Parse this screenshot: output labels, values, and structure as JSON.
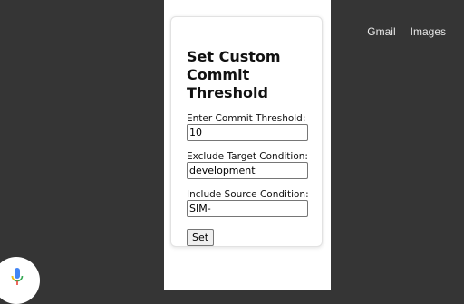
{
  "header": {
    "links": [
      {
        "label": "Gmail"
      },
      {
        "label": "Images"
      }
    ]
  },
  "popup": {
    "title": "Set Custom Commit Threshold",
    "fields": [
      {
        "label": "Enter Commit Threshold:",
        "value": "10"
      },
      {
        "label": "Exclude Target Condition:",
        "value": "development"
      },
      {
        "label": "Include Source Condition:",
        "value": "SIM-"
      }
    ],
    "submit_label": "Set"
  },
  "voice": {
    "icon": "microphone-icon",
    "colors": {
      "blue": "#4285f4",
      "red": "#ea4335",
      "yellow": "#fbbc04",
      "green": "#34a853"
    }
  }
}
